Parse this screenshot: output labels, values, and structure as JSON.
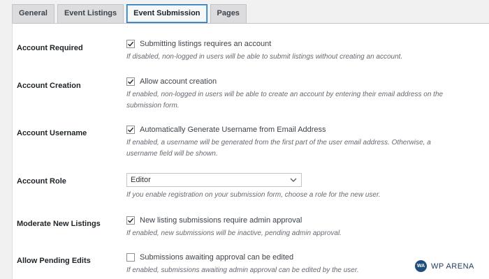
{
  "tabs": [
    {
      "label": "General"
    },
    {
      "label": "Event Listings"
    },
    {
      "label": "Event Submission"
    },
    {
      "label": "Pages"
    }
  ],
  "settings": {
    "account_required": {
      "label": "Account Required",
      "option": "Submitting listings requires an account",
      "checked": true,
      "description": "If disabled, non-logged in users will be able to submit listings without creating an account."
    },
    "account_creation": {
      "label": "Account Creation",
      "option": "Allow account creation",
      "checked": true,
      "description": "If enabled, non-logged in users will be able to create an account by entering their email address on the submission form."
    },
    "account_username": {
      "label": "Account Username",
      "option": "Automatically Generate Username from Email Address",
      "checked": true,
      "description": "If enabled, a username will be generated from the first part of the user email address. Otherwise, a username field will be shown."
    },
    "account_role": {
      "label": "Account Role",
      "selected": "Editor",
      "description": "If you enable registration on your submission form, choose a role for the new user."
    },
    "moderate_new_listings": {
      "label": "Moderate New Listings",
      "option": "New listing submissions require admin approval",
      "checked": true,
      "description": "If enabled, new submissions will be inactive, pending admin approval."
    },
    "allow_pending_edits": {
      "label": "Allow Pending Edits",
      "option": "Submissions awaiting approval can be edited",
      "checked": false,
      "description": "If enabled, submissions awaiting admin approval can be edited by the user."
    }
  },
  "brand": {
    "logo_text": "WA",
    "name": "WP ARENA"
  }
}
